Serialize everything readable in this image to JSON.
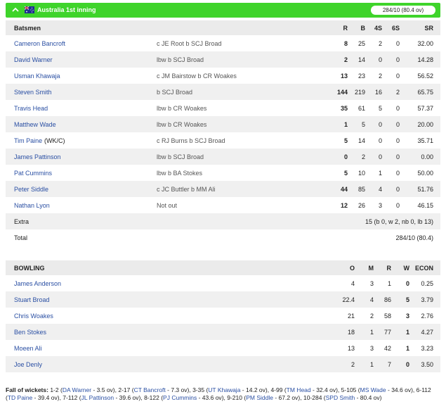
{
  "header": {
    "title": "Australia 1st inning",
    "score": "284/10 (80.4 ov)"
  },
  "batting": {
    "columns": [
      "Batsmen",
      "R",
      "B",
      "4S",
      "6S",
      "SR"
    ],
    "rows": [
      {
        "name": "Cameron Bancroft",
        "dismissal": "c JE Root b SCJ Broad",
        "r": "8",
        "b": "25",
        "fours": "2",
        "sixes": "0",
        "sr": "32.00"
      },
      {
        "name": "David Warner",
        "dismissal": "lbw b SCJ Broad",
        "r": "2",
        "b": "14",
        "fours": "0",
        "sixes": "0",
        "sr": "14.28"
      },
      {
        "name": "Usman Khawaja",
        "dismissal": "c JM Bairstow b CR Woakes",
        "r": "13",
        "b": "23",
        "fours": "2",
        "sixes": "0",
        "sr": "56.52"
      },
      {
        "name": "Steven Smith",
        "dismissal": "b SCJ Broad",
        "r": "144",
        "b": "219",
        "fours": "16",
        "sixes": "2",
        "sr": "65.75"
      },
      {
        "name": "Travis Head",
        "dismissal": "lbw b CR Woakes",
        "r": "35",
        "b": "61",
        "fours": "5",
        "sixes": "0",
        "sr": "57.37"
      },
      {
        "name": "Matthew Wade",
        "dismissal": "lbw b CR Woakes",
        "r": "1",
        "b": "5",
        "fours": "0",
        "sixes": "0",
        "sr": "20.00"
      },
      {
        "name": "Tim Paine",
        "tag": "(WK/C)",
        "dismissal": "c RJ Burns b SCJ Broad",
        "r": "5",
        "b": "14",
        "fours": "0",
        "sixes": "0",
        "sr": "35.71"
      },
      {
        "name": "James Pattinson",
        "dismissal": "lbw b SCJ Broad",
        "r": "0",
        "b": "2",
        "fours": "0",
        "sixes": "0",
        "sr": "0.00"
      },
      {
        "name": "Pat Cummins",
        "dismissal": "lbw b BA Stokes",
        "r": "5",
        "b": "10",
        "fours": "1",
        "sixes": "0",
        "sr": "50.00"
      },
      {
        "name": "Peter Siddle",
        "dismissal": "c JC Buttler b MM Ali",
        "r": "44",
        "b": "85",
        "fours": "4",
        "sixes": "0",
        "sr": "51.76"
      },
      {
        "name": "Nathan Lyon",
        "dismissal": "Not out",
        "r": "12",
        "b": "26",
        "fours": "3",
        "sixes": "0",
        "sr": "46.15"
      }
    ],
    "extra_label": "Extra",
    "extra_value": "15 (b 0, w 2, nb 0, lb 13)",
    "total_label": "Total",
    "total_value": "284/10 (80.4)"
  },
  "bowling": {
    "columns": [
      "BOWLING",
      "O",
      "M",
      "R",
      "W",
      "ECON"
    ],
    "rows": [
      {
        "name": "James Anderson",
        "o": "4",
        "m": "3",
        "r": "1",
        "w": "0",
        "econ": "0.25"
      },
      {
        "name": "Stuart Broad",
        "o": "22.4",
        "m": "4",
        "r": "86",
        "w": "5",
        "econ": "3.79"
      },
      {
        "name": "Chris Woakes",
        "o": "21",
        "m": "2",
        "r": "58",
        "w": "3",
        "econ": "2.76"
      },
      {
        "name": "Ben Stokes",
        "o": "18",
        "m": "1",
        "r": "77",
        "w": "1",
        "econ": "4.27"
      },
      {
        "name": "Moeen Ali",
        "o": "13",
        "m": "3",
        "r": "42",
        "w": "1",
        "econ": "3.23"
      },
      {
        "name": "Joe Denly",
        "o": "2",
        "m": "1",
        "r": "7",
        "w": "0",
        "econ": "3.50"
      }
    ]
  },
  "fall_of_wickets": {
    "label": "Fall of wickets:",
    "items": [
      {
        "score": "1-2",
        "player": "DA Warner",
        "over": "3.5 ov"
      },
      {
        "score": "2-17",
        "player": "CT Bancroft",
        "over": "7.3 ov"
      },
      {
        "score": "3-35",
        "player": "UT Khawaja",
        "over": "14.2 ov"
      },
      {
        "score": "4-99",
        "player": "TM Head",
        "over": "32.4 ov"
      },
      {
        "score": "5-105",
        "player": "MS Wade",
        "over": "34.6 ov"
      },
      {
        "score": "6-112",
        "player": "TD Paine",
        "over": "39.4 ov"
      },
      {
        "score": "7-112",
        "player": "JL Pattinson",
        "over": "39.6 ov"
      },
      {
        "score": "8-122",
        "player": "PJ Cummins",
        "over": "43.6 ov"
      },
      {
        "score": "9-210",
        "player": "PM Siddle",
        "over": "67.2 ov"
      },
      {
        "score": "10-284",
        "player": "SPD Smith",
        "over": "80.4 ov"
      }
    ]
  }
}
